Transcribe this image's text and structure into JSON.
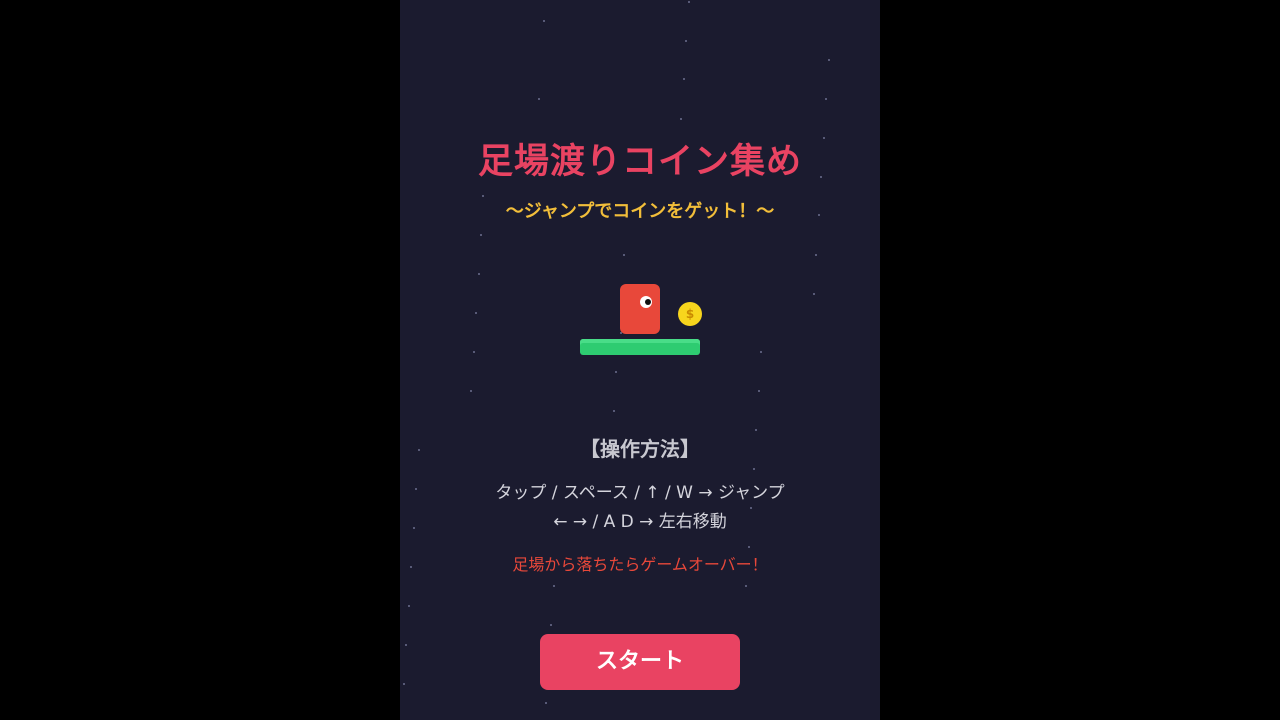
{
  "game": {
    "title": "足場渡りコイン集め",
    "subtitle": "〜ジャンプでコインをゲット！〜",
    "coin_symbol": "$",
    "howto": {
      "heading": "【操作方法】",
      "line1": "タップ / スペース / ↑ / W → ジャンプ",
      "line2": "← → / A D → 左右移動"
    },
    "warning": "足場から落ちたらゲームオーバー！",
    "start_label": "スタート"
  },
  "colors": {
    "background": "#1b1b2f",
    "title": "#e94362",
    "subtitle": "#f2be3a",
    "player": "#e8483a",
    "coin": "#f7d51d",
    "platform": "#2ecc71",
    "button": "#e94362"
  }
}
